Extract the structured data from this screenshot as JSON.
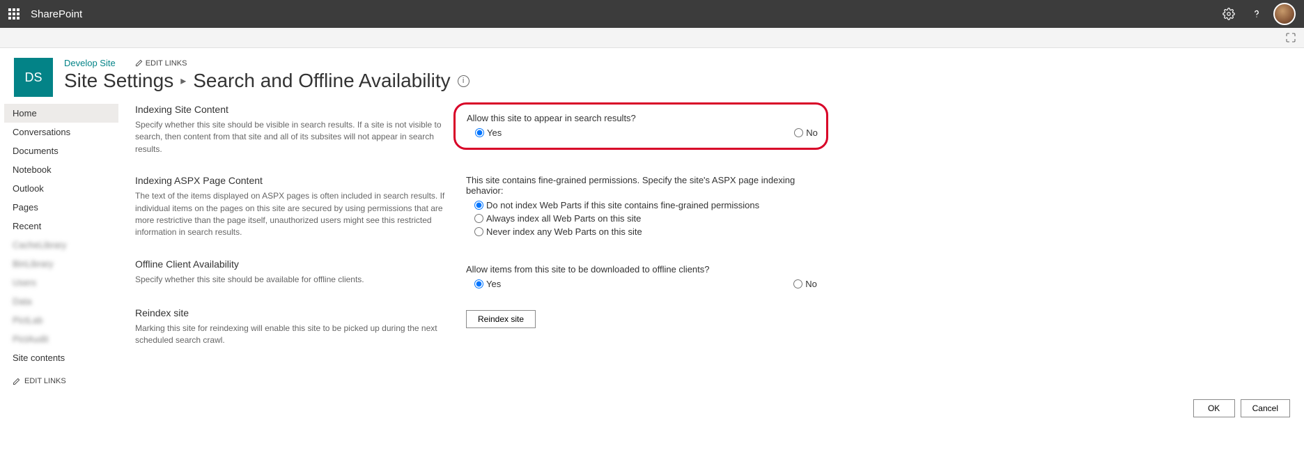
{
  "suitebar": {
    "app_name": "SharePoint"
  },
  "header": {
    "site_logo_initials": "DS",
    "site_link": "Develop Site",
    "edit_links_label": "EDIT LINKS",
    "breadcrumb_root": "Site Settings",
    "page_title": "Search and Offline Availability"
  },
  "leftnav": {
    "items": [
      {
        "label": "Home",
        "selected": true
      },
      {
        "label": "Conversations"
      },
      {
        "label": "Documents"
      },
      {
        "label": "Notebook"
      },
      {
        "label": "Outlook"
      },
      {
        "label": "Pages"
      },
      {
        "label": "Recent"
      },
      {
        "label": "CacheLibrary",
        "blurred": true
      },
      {
        "label": "BinLibrary",
        "blurred": true
      },
      {
        "label": "Users",
        "blurred": true
      },
      {
        "label": "Data",
        "blurred": true
      },
      {
        "label": "PictLab",
        "blurred": true
      },
      {
        "label": "PictAudit",
        "blurred": true
      },
      {
        "label": "Site contents"
      }
    ],
    "edit_links_label": "EDIT LINKS"
  },
  "sections": {
    "indexing_site": {
      "heading": "Indexing Site Content",
      "description": "Specify whether this site should be visible in search results. If a site is not visible to search, then content from that site and all of its subsites will not appear in search results.",
      "question": "Allow this site to appear in search results?",
      "option_yes": "Yes",
      "option_no": "No",
      "selected": "Yes"
    },
    "indexing_aspx": {
      "heading": "Indexing ASPX Page Content",
      "description": "The text of the items displayed on ASPX pages is often included in search results. If individual items on the pages on this site are secured by using permissions that are more restrictive than the page itself, unauthorized users might see this restricted information in search results.",
      "question": "This site contains fine-grained permissions. Specify the site's ASPX page indexing behavior:",
      "options": [
        "Do not index Web Parts if this site contains fine-grained permissions",
        "Always index all Web Parts on this site",
        "Never index any Web Parts on this site"
      ],
      "selected_index": 0
    },
    "offline": {
      "heading": "Offline Client Availability",
      "description": "Specify whether this site should be available for offline clients.",
      "question": "Allow items from this site to be downloaded to offline clients?",
      "option_yes": "Yes",
      "option_no": "No",
      "selected": "Yes"
    },
    "reindex": {
      "heading": "Reindex site",
      "description": "Marking this site for reindexing will enable this site to be picked up during the next scheduled search crawl.",
      "button_label": "Reindex site"
    }
  },
  "footer": {
    "ok_label": "OK",
    "cancel_label": "Cancel"
  }
}
